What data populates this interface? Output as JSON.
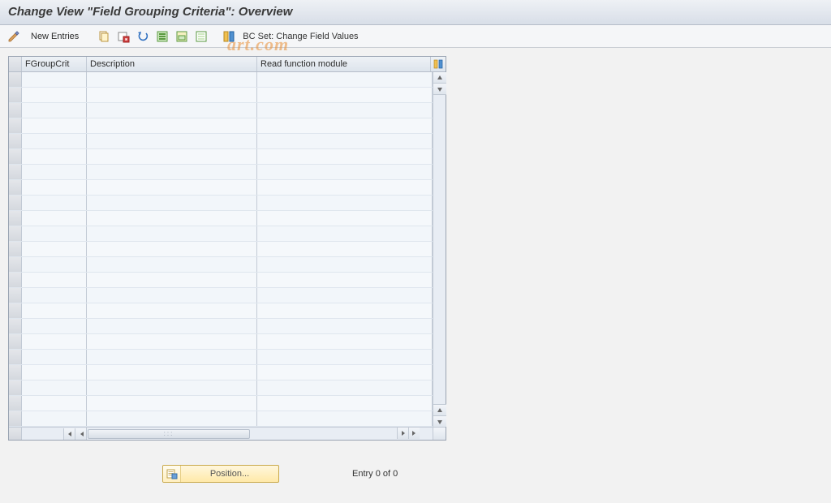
{
  "header": {
    "title": "Change View \"Field Grouping Criteria\": Overview"
  },
  "toolbar": {
    "new_entries_label": "New Entries",
    "bcset_label": "BC Set: Change Field Values"
  },
  "table": {
    "columns": {
      "fgroupcrit": "FGroupCrit",
      "description": "Description",
      "read_fn": "Read function module"
    },
    "visible_row_count": 23
  },
  "footer": {
    "position_label": "Position...",
    "entry_status": "Entry 0 of 0"
  },
  "watermark": "art.com"
}
